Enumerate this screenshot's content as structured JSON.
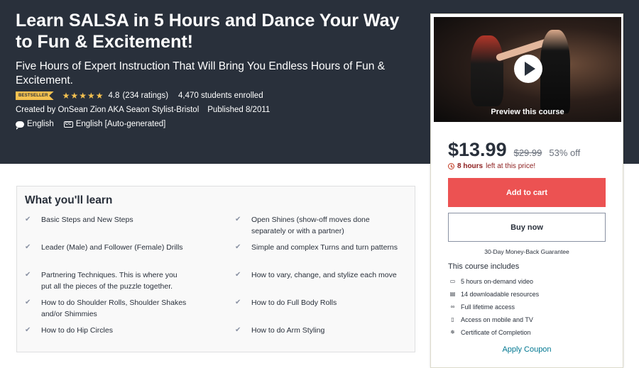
{
  "course": {
    "title": "Learn SALSA in 5 Hours and Dance Your Way to Fun & Excitement!",
    "subtitle": "Five Hours of Expert Instruction That Will Bring You Endless Hours of Fun & Excitement.",
    "badge": "BESTSELLER",
    "rating": "4.8",
    "rating_count": "(234 ratings)",
    "stars": 4.8,
    "enrolled": "4,470 students enrolled",
    "created_by": "Created by OnSean Zion AKA Seaon Stylist-Bristol",
    "published": "Published 8/2011",
    "language": "English",
    "captions": "English [Auto-generated]"
  },
  "learn": {
    "heading": "What you'll learn",
    "items": [
      "Basic Steps and New Steps",
      "Open Shines (show-off moves done separately or with a partner)",
      "Leader (Male) and Follower (Female) Drills",
      "Simple and complex Turns and turn patterns",
      "Partnering Techniques. This is where you put all the pieces of the puzzle together.",
      "How to vary, change, and stylize each move",
      "How to do Shoulder Rolls, Shoulder Shakes and/or Shimmies",
      "How to do Full Body Rolls",
      "How to do Hip Circles",
      "How to do Arm Styling"
    ]
  },
  "sidebar": {
    "preview_label": "Preview this course",
    "price": "$13.99",
    "original_price": "$29.99",
    "discount": "53% off",
    "timer_bold": "8 hours",
    "timer_text": "left at this price!",
    "add_to_cart": "Add to cart",
    "buy_now": "Buy now",
    "guarantee": "30-Day Money-Back Guarantee",
    "includes_title": "This course includes",
    "includes": [
      {
        "icon": "video-icon",
        "text": "5 hours on-demand video"
      },
      {
        "icon": "file-icon",
        "text": "14 downloadable resources"
      },
      {
        "icon": "infinity-icon",
        "text": "Full lifetime access"
      },
      {
        "icon": "mobile-icon",
        "text": "Access on mobile and TV"
      },
      {
        "icon": "trophy-icon",
        "text": "Certificate of Completion"
      }
    ],
    "coupon": "Apply Coupon"
  },
  "colors": {
    "hero_bg": "#29303b",
    "star": "#f4c150",
    "cart_button": "#ec5252",
    "link": "#007791"
  }
}
